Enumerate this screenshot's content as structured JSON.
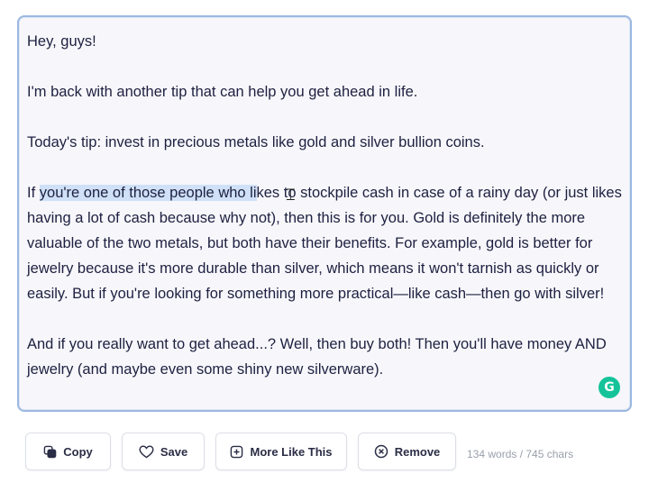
{
  "editor": {
    "paragraphs": [
      {
        "text": "Hey, guys!"
      },
      {
        "text": "I'm back with another tip that can help you get ahead in life."
      },
      {
        "text": "Today's tip: invest in precious metals like gold and silver bullion coins."
      },
      {
        "before": "If ",
        "highlight": "you're one of those people who li",
        "after": "kes to stockpile cash in case of a rainy day (or just likes having a lot of cash because why not), then this is for you. Gold is definitely the more valuable of the two metals, but both have their benefits. For example, gold is better for jewelry because it's more durable than silver, which means it won't tarnish as quickly or easily. But if you're looking for something more practical—like cash—then go with silver!"
      },
      {
        "text": "And if you really want to get ahead...? Well, then buy both! Then you'll have money AND jewelry (and maybe even some shiny new silverware)."
      }
    ],
    "highlight_color": "#cfe0f7",
    "border_color": "#9bb8e2",
    "assistant_badge": "G"
  },
  "actions": {
    "copy": "Copy",
    "save": "Save",
    "more_like_this": "More Like This",
    "remove": "Remove"
  },
  "counter": "134 words / 745 chars"
}
